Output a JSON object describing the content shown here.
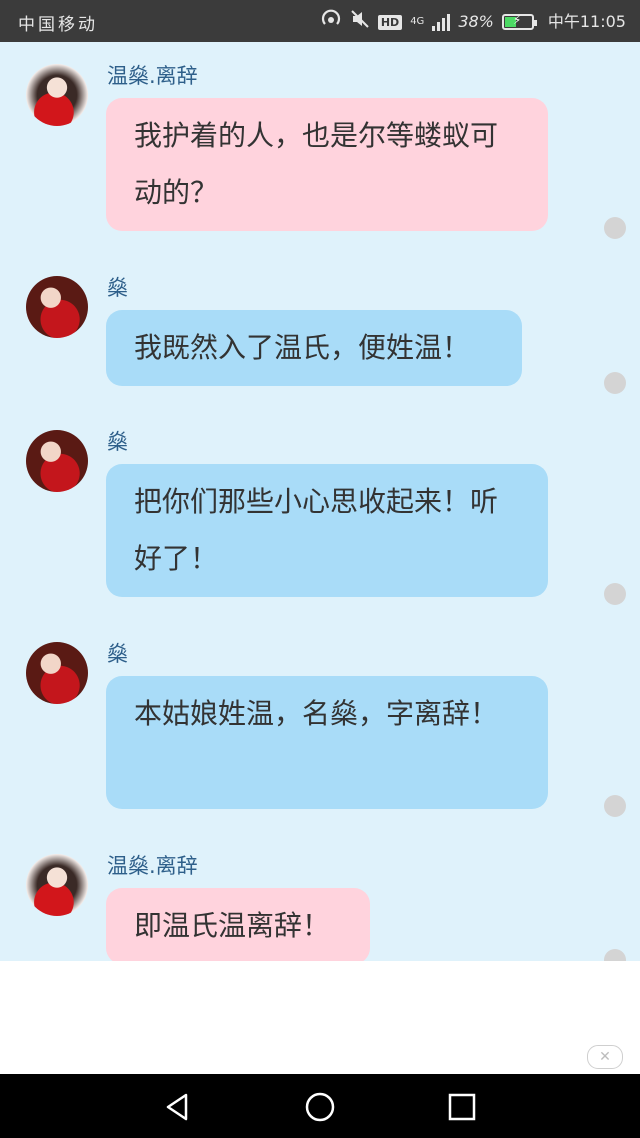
{
  "status_bar": {
    "carrier": "中国移动",
    "network": "4G",
    "hd": "HD",
    "battery": "38%",
    "time": "中午11:05",
    "battery_level": 0.38,
    "icons": [
      "hotspot-icon",
      "mute-icon",
      "signal-icon",
      "battery-icon"
    ]
  },
  "messages": [
    {
      "sender": "温燊.离辞",
      "text": "我护着的人，也是尔等蝼蚁可动的？",
      "bubble_color": "#ffd3dd"
    },
    {
      "sender": "燊",
      "text": "我既然入了温氏，便姓温！",
      "bubble_color": "#a9dcf8"
    },
    {
      "sender": "燊",
      "text": "把你们那些小心思收起来！听好了！",
      "bubble_color": "#a9dcf8"
    },
    {
      "sender": "燊",
      "text": "本姑娘姓温，名燊，字离辞！",
      "bubble_color": "#a9dcf8"
    },
    {
      "sender": "温燊.离辞",
      "text": "即温氏温离辞！",
      "bubble_color": "#ffd3dd"
    }
  ],
  "nav_bar": {
    "icons": [
      "back-icon",
      "home-icon",
      "recents-icon"
    ]
  },
  "ad": {
    "close_icon": "close-icon"
  },
  "colors": {
    "chat_background": "#dff2fb",
    "pink_bubble": "#ffd3dd",
    "blue_bubble": "#a9dcf8",
    "name_color": "#2e5f8a"
  }
}
